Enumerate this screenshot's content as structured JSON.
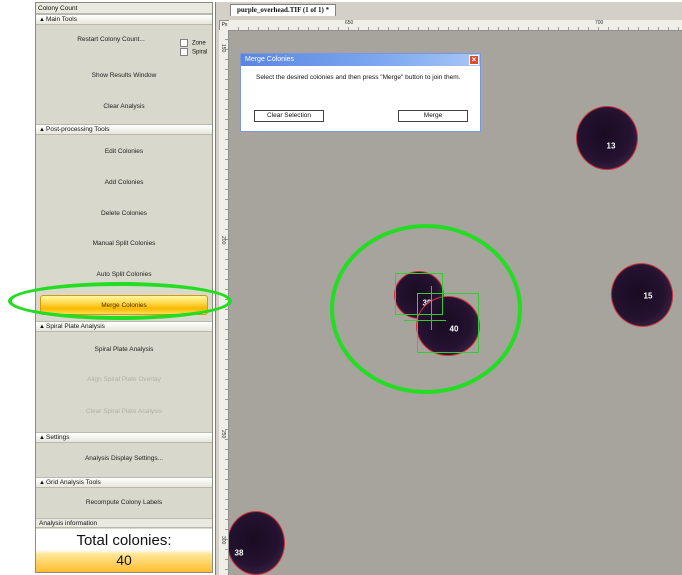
{
  "left_panel": {
    "title": "Colony Count",
    "main_tools": {
      "header": "Main Tools",
      "restart": "Restart Colony Count...",
      "zone": "Zone",
      "spiral": "Spiral",
      "show_results": "Show Results Window",
      "clear_analysis": "Clear Analysis"
    },
    "post_processing": {
      "header": "Post-processing Tools",
      "edit": "Edit Colonies",
      "add": "Add Colonies",
      "delete": "Delete Colonies",
      "manual_split": "Manual Split Colonies",
      "auto_split": "Auto Split Colonies",
      "merge": "Merge Colonies"
    },
    "spiral_plate": {
      "header": "Spiral Plate Analysis",
      "analysis": "Spiral Plate Analysis",
      "align": "Align Spiral Plate Overlay",
      "clear": "Clear Spiral Plate Analysis"
    },
    "settings": {
      "header": "Settings",
      "display": "Analysis Display Settings..."
    },
    "grid": {
      "header": "Grid Analysis Tools",
      "recompute": "Recompute Colony Labels"
    },
    "info": {
      "header": "Analysis information",
      "total_label": "Total colonies:",
      "total_value": "40"
    }
  },
  "image_window": {
    "tab_title": "purple_overhead.TIF (1 of 1) *",
    "units": "Px",
    "ruler_top": [
      "650",
      "700"
    ],
    "ruler_left": [
      "150",
      "200",
      "250",
      "300"
    ],
    "colonies": [
      "13",
      "15",
      "39",
      "40",
      "38"
    ]
  },
  "merge_dialog": {
    "title": "Merge Colonies",
    "message": "Select the desired colonies and then press \"Merge\" button to join them.",
    "clear_selection": "Clear Selection",
    "merge": "Merge",
    "close": "×"
  }
}
